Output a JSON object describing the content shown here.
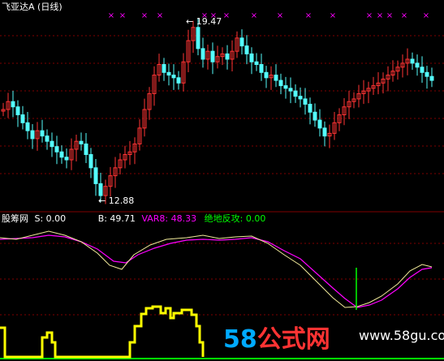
{
  "stock": {
    "title": "飞亚达A (日线)",
    "high_label": "19.47",
    "low_label": "12.88",
    "high_value": 19.47,
    "low_value": 12.88
  },
  "indicator": {
    "name": "股筹网",
    "s_label": "S: 0.00",
    "b_label": "B: 49.71",
    "var8_label": "VAR8: 48.33",
    "fangong_label": "绝地反攻: 0.00"
  },
  "watermark": {
    "left_digits": "58",
    "left_chars": "公式网",
    "right_text": "www.58gu.com"
  },
  "colors": {
    "background": "#000000",
    "up_candle": "#ff3333",
    "down_candle": "#54fcfc",
    "grid": "#800000",
    "marker": "#ff00ff",
    "s_line": "#ffffff",
    "b_line": "#ffff00",
    "var8_line": "#ff00ff",
    "fangong_line": "#00ff00",
    "bar_yellow": "#ffff00",
    "wm_blue": "#00aaff",
    "wm_red": "#ff3333"
  }
}
